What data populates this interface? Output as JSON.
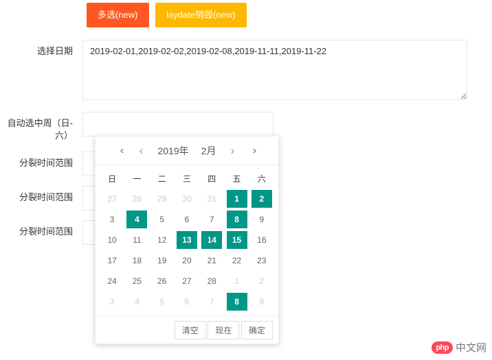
{
  "buttons": {
    "multi_select": "多选(new)",
    "destroy": "laydate销毁(new)"
  },
  "fields": {
    "select_date": {
      "label": "选择日期",
      "value": "2019-02-01,2019-02-02,2019-02-08,2019-11-11,2019-11-22"
    },
    "auto_week": {
      "label": "自动选中周（日-六）",
      "value": ""
    },
    "split_range_1": {
      "label": "分裂时间范围",
      "value": ""
    },
    "split_range_2": {
      "label": "分裂时间范围",
      "value": ""
    },
    "split_range_3": {
      "label": "分裂时间范围",
      "value": ""
    }
  },
  "calendar": {
    "year_label": "2019年",
    "month_label": "2月",
    "weekdays": [
      "日",
      "一",
      "二",
      "三",
      "四",
      "五",
      "六"
    ],
    "grid": [
      [
        {
          "d": 27,
          "other": true
        },
        {
          "d": 28,
          "other": true
        },
        {
          "d": 29,
          "other": true
        },
        {
          "d": 30,
          "other": true
        },
        {
          "d": 31,
          "other": true
        },
        {
          "d": 1,
          "selected": true
        },
        {
          "d": 2,
          "selected": true
        }
      ],
      [
        {
          "d": 3
        },
        {
          "d": 4,
          "selected": true
        },
        {
          "d": 5
        },
        {
          "d": 6
        },
        {
          "d": 7
        },
        {
          "d": 8,
          "selected": true
        },
        {
          "d": 9
        }
      ],
      [
        {
          "d": 10
        },
        {
          "d": 11
        },
        {
          "d": 12
        },
        {
          "d": 13,
          "selected": true
        },
        {
          "d": 14,
          "selected": true
        },
        {
          "d": 15,
          "selected": true
        },
        {
          "d": 16
        }
      ],
      [
        {
          "d": 17
        },
        {
          "d": 18
        },
        {
          "d": 19
        },
        {
          "d": 20
        },
        {
          "d": 21
        },
        {
          "d": 22
        },
        {
          "d": 23
        }
      ],
      [
        {
          "d": 24
        },
        {
          "d": 25
        },
        {
          "d": 26
        },
        {
          "d": 27
        },
        {
          "d": 28
        },
        {
          "d": 1,
          "other": true
        },
        {
          "d": 2,
          "other": true
        }
      ],
      [
        {
          "d": 3,
          "other": true
        },
        {
          "d": 4,
          "other": true
        },
        {
          "d": 5,
          "other": true
        },
        {
          "d": 6,
          "other": true
        },
        {
          "d": 7,
          "other": true
        },
        {
          "d": 8,
          "other": true,
          "selected": true
        },
        {
          "d": 9,
          "other": true
        }
      ]
    ],
    "footer": {
      "clear": "清空",
      "now": "现在",
      "confirm": "确定"
    }
  },
  "logo": {
    "badge": "php",
    "text": "中文网"
  }
}
